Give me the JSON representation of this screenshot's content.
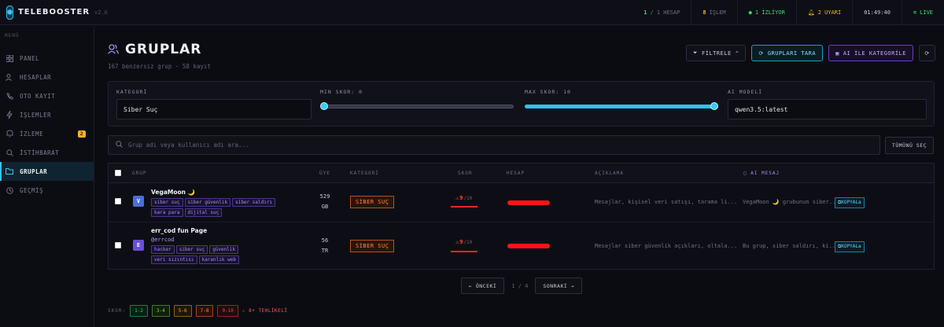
{
  "app": {
    "name": "TELEBOOSTER",
    "version": "v2.0"
  },
  "stats": {
    "hesap_n": "1",
    "hesap_label": "/ 1 HESAP",
    "islem_n": "8",
    "islem_label": "İŞLEM",
    "izliyor": "1 İZLİYOR",
    "uyari": "2 UYARI",
    "time": "01:49:40",
    "live": "LIVE"
  },
  "colors": {
    "accent": "#38c6f4",
    "purple": "#a98cf0",
    "danger": "#ff4444",
    "warning": "#f5b41e",
    "success": "#3ddc6f"
  },
  "sidebar": {
    "label": "MENÜ",
    "items": [
      {
        "label": "PANEL",
        "icon": "grid-icon"
      },
      {
        "label": "HESAPLAR",
        "icon": "users-icon"
      },
      {
        "label": "OTO KAYIT",
        "icon": "phone-icon"
      },
      {
        "label": "İŞLEMLER",
        "icon": "bolt-icon"
      },
      {
        "label": "İZLEME",
        "icon": "bell-icon",
        "badge": "2"
      },
      {
        "label": "İSTİHBARAT",
        "icon": "search-icon"
      },
      {
        "label": "GRUPLAR",
        "icon": "folder-icon",
        "active": true
      },
      {
        "label": "GEÇMİŞ",
        "icon": "history-icon"
      }
    ]
  },
  "page": {
    "title": "GRUPLAR",
    "subtitle": "167 benzersiz grup · 58 kayıt"
  },
  "actions": {
    "filter": "FİLTRELE",
    "scan": "GRUPLARI TARA",
    "ai": "AI İLE KATEGORİLE"
  },
  "filters": {
    "kategori_label": "KATEGORİ",
    "kategori_value": "Siber Suç",
    "min_label": "MIN SKOR: 0",
    "min_value": 0,
    "max_label": "MAX SKOR: 10",
    "max_value": 10,
    "model_label": "AI MODELİ",
    "model_value": "qwen3.5:latest"
  },
  "search": {
    "placeholder": "Grup adı veya kullanıcı adı ara...",
    "select_all": "TÜMÜNÜ SEÇ"
  },
  "table": {
    "headers": {
      "grup": "GRUP",
      "uye": "ÜYE",
      "kategori": "KATEGORİ",
      "skor": "SKOR",
      "hesap": "HESAP",
      "aciklama": "AÇIKLAMA",
      "ai_mesaj": "AI MESAJ"
    },
    "rows": [
      {
        "avatar": "V",
        "name": "VegaMoon 🌙",
        "handle": "",
        "tags": [
          "siber suç",
          "siber güvenlik",
          "siber saldırı",
          "kara para",
          "dijital suç"
        ],
        "uye": "529",
        "uye_unit": "GB",
        "kategori": "SİBER SUÇ",
        "skor": "9",
        "skor_max": "/10",
        "aciklama": "Mesajlar, kişisel veri satışı, tarama li...",
        "ai_mesaj": "VegaMoon 🌙 grubunun siber...",
        "kopya": "KOPYALa"
      },
      {
        "avatar": "E",
        "name": "err_cod fun Page",
        "handle": "@errcod",
        "tags": [
          "hacker",
          "siber suç",
          "güvenlik",
          "veri sızıntısı",
          "karanlık web"
        ],
        "uye": "56",
        "uye_unit": "TR",
        "kategori": "SİBER SUÇ",
        "skor": "9",
        "skor_max": "/10",
        "aciklama": "Mesajlar siber güvenlik açıkları, oltala...",
        "ai_mesaj": "Bu grup, siber saldırı, ki...",
        "kopya": "KOPYALa"
      }
    ]
  },
  "pagination": {
    "prev": "← ÖNCEKİ",
    "info": "1 / 4",
    "next": "SONRAKİ →"
  },
  "legend": {
    "label": "SKOR:",
    "items": [
      "1-2",
      "3-4",
      "5-6",
      "7-8",
      "9-10"
    ],
    "danger": "8+ TEHLİKELİ"
  }
}
